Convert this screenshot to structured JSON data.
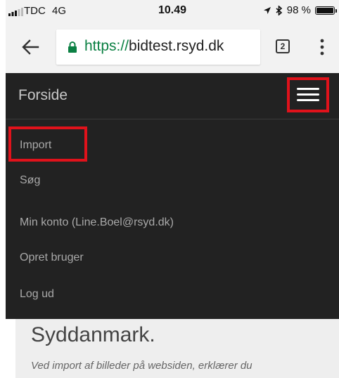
{
  "status_bar": {
    "carrier": "TDC",
    "network": "4G",
    "time": "10.49",
    "indicators": [
      "location-arrow-icon",
      "bluetooth-icon"
    ],
    "battery_text": "98 %",
    "battery_level": 0.98
  },
  "browser": {
    "url_scheme": "https://",
    "url_host": "bidtest.rsyd.dk",
    "tab_count": "2"
  },
  "navbar": {
    "brand": "Forside"
  },
  "menu": {
    "items": [
      {
        "label": "Import"
      },
      {
        "label": "Søg"
      },
      {
        "label": "Min konto (Line.Boel@rsyd.dk)"
      },
      {
        "label": "Opret bruger"
      },
      {
        "label": "Log ud"
      }
    ]
  },
  "content": {
    "heading": "Syddanmark.",
    "text": "Ved import af billeder på websiden, erklærer du"
  },
  "colors": {
    "navbar_bg": "#222222",
    "highlight": "#e0121b",
    "secure": "#0b8043"
  }
}
